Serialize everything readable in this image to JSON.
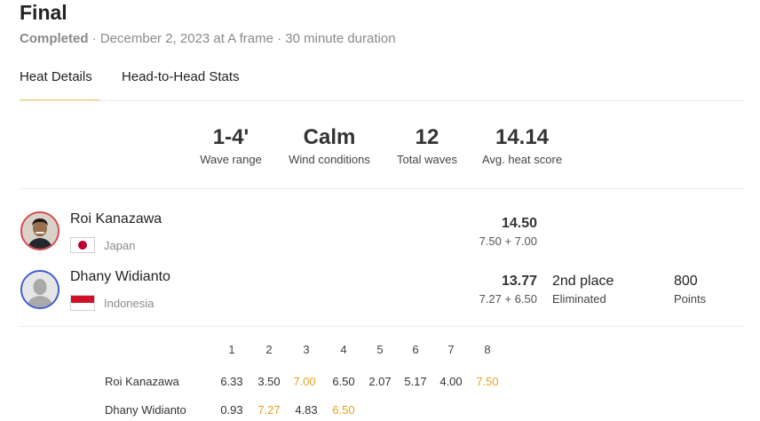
{
  "header": {
    "title": "Final",
    "status": "Completed",
    "details": " · December 2, 2023 at A frame · 30 minute duration"
  },
  "tabs": [
    {
      "label": "Heat Details",
      "active": true
    },
    {
      "label": "Head-to-Head Stats",
      "active": false
    }
  ],
  "stats": [
    {
      "value": "1-4'",
      "label": "Wave range"
    },
    {
      "value": "Calm",
      "label": "Wind conditions"
    },
    {
      "value": "12",
      "label": "Total waves"
    },
    {
      "value": "14.14",
      "label": "Avg. heat score"
    }
  ],
  "surfers": [
    {
      "name": "Roi Kanazawa",
      "country": "Japan",
      "total": "14.50",
      "breakdown": "7.50 + 7.00",
      "flag_icon": "japan-flag-icon",
      "ring_color": "#d7464d"
    },
    {
      "name": "Dhany Widianto",
      "country": "Indonesia",
      "total": "13.77",
      "breakdown": "7.27 + 6.50",
      "place": "2nd place",
      "result": "Eliminated",
      "points": "800",
      "points_label": "Points",
      "flag_icon": "indonesia-flag-icon",
      "ring_color": "#3b5bcc"
    }
  ],
  "wave_table": {
    "columns": [
      "1",
      "2",
      "3",
      "4",
      "5",
      "6",
      "7",
      "8"
    ],
    "rows": [
      {
        "name": "Roi Kanazawa",
        "scores": [
          "6.33",
          "3.50",
          "7.00",
          "6.50",
          "2.07",
          "5.17",
          "4.00",
          "7.50"
        ],
        "counted": [
          2,
          7
        ]
      },
      {
        "name": "Dhany Widianto",
        "scores": [
          "0.93",
          "7.27",
          "4.83",
          "6.50"
        ],
        "counted": [
          1,
          3
        ]
      }
    ],
    "counted_color": "#e9a31d"
  },
  "colors": {
    "tab_underline": "#f3c869"
  }
}
